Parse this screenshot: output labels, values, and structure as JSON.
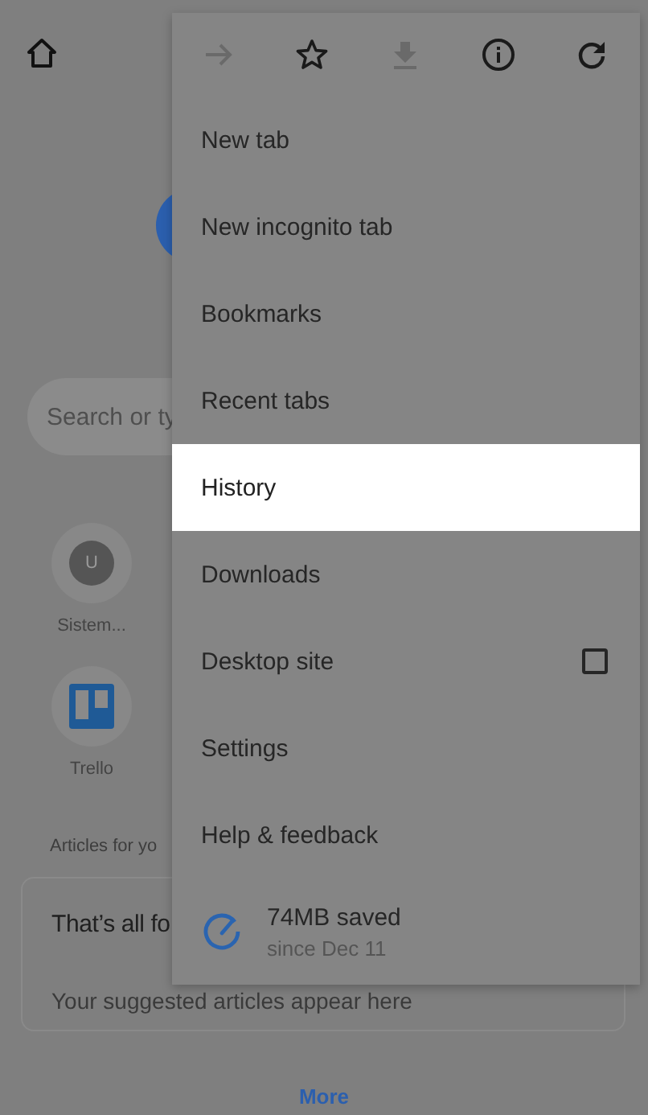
{
  "page": {
    "search": {
      "placeholder": "Search or ty"
    },
    "tiles": [
      {
        "kind": "letter",
        "letter": "U",
        "label": "Sistem..."
      },
      {
        "kind": "board",
        "label": "Trello"
      }
    ],
    "articles_heading": "Articles for yo",
    "card": {
      "title": "That’s all fo",
      "text": "Your suggested articles appear here"
    },
    "more_link": "More"
  },
  "menu": {
    "toolbar": [
      {
        "kind": "forward",
        "disabled": true
      },
      {
        "kind": "star",
        "disabled": false
      },
      {
        "kind": "download",
        "disabled": true
      },
      {
        "kind": "info",
        "disabled": false
      },
      {
        "kind": "refresh",
        "disabled": false
      }
    ],
    "items": [
      {
        "kind": "plain",
        "label": "New tab",
        "selected": false
      },
      {
        "kind": "plain",
        "label": "New incognito tab",
        "selected": false
      },
      {
        "kind": "plain",
        "label": "Bookmarks",
        "selected": false
      },
      {
        "kind": "plain",
        "label": "Recent tabs",
        "selected": false
      },
      {
        "kind": "plain",
        "label": "History",
        "selected": true
      },
      {
        "kind": "plain",
        "label": "Downloads",
        "selected": false
      },
      {
        "kind": "checkbox",
        "label": "Desktop site",
        "selected": false,
        "checked": false
      },
      {
        "kind": "plain",
        "label": "Settings",
        "selected": false
      },
      {
        "kind": "plain",
        "label": "Help & feedback",
        "selected": false
      },
      {
        "kind": "saver",
        "label": "74MB saved",
        "sublabel": "since Dec 11",
        "selected": false
      }
    ]
  }
}
